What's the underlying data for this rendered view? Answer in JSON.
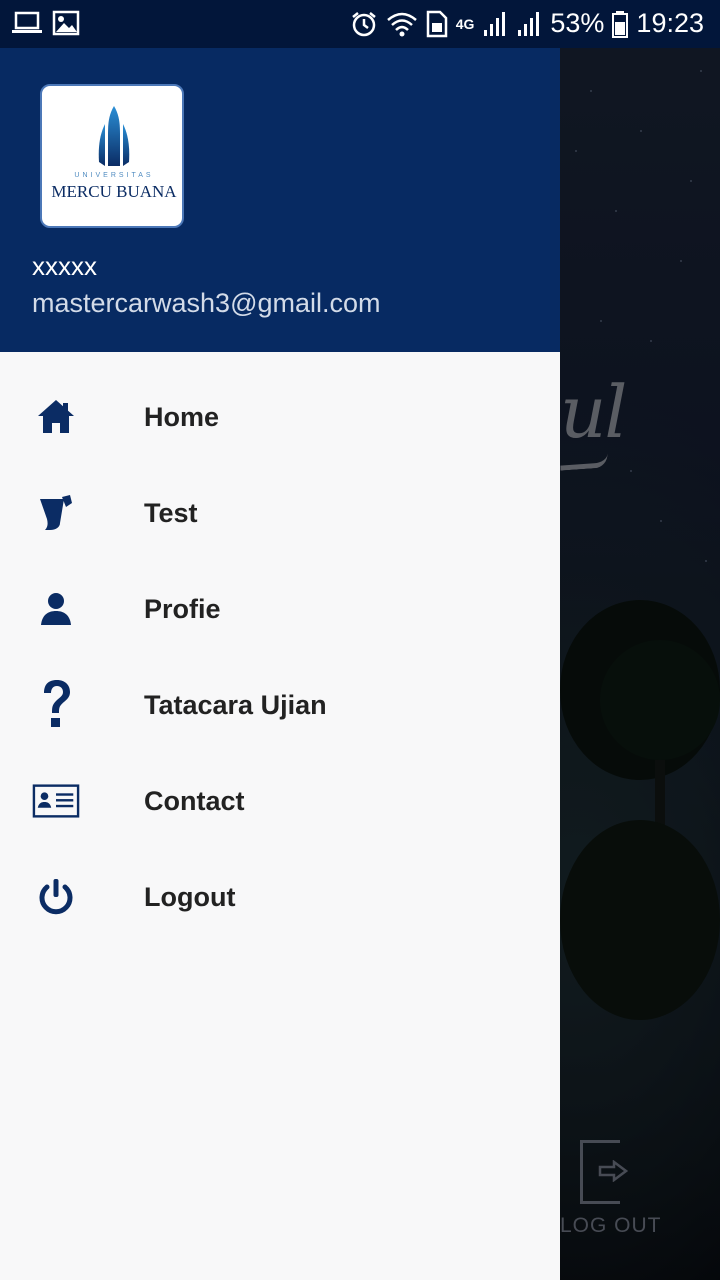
{
  "status_bar": {
    "battery": "53%",
    "time": "19:23",
    "network": "4G"
  },
  "drawer": {
    "logo": {
      "small_text": "UNIVERSITAS",
      "text": "MERCU BUANA"
    },
    "user_name": "xxxxx",
    "user_email": "mastercarwash3@gmail.com",
    "menu": [
      {
        "label": "Home",
        "icon": "home-icon"
      },
      {
        "label": "Test",
        "icon": "test-icon"
      },
      {
        "label": "Profie",
        "icon": "profile-icon"
      },
      {
        "label": "Tatacara Ujian",
        "icon": "help-icon"
      },
      {
        "label": "Contact",
        "icon": "contact-card-icon"
      },
      {
        "label": "Logout",
        "icon": "power-icon"
      }
    ]
  },
  "background": {
    "logout_label": "LOG OUT"
  },
  "colors": {
    "header": "#072a62",
    "status_bar": "#02163a",
    "icon": "#0b2c64",
    "drawer_bg": "#f8f8f9"
  }
}
